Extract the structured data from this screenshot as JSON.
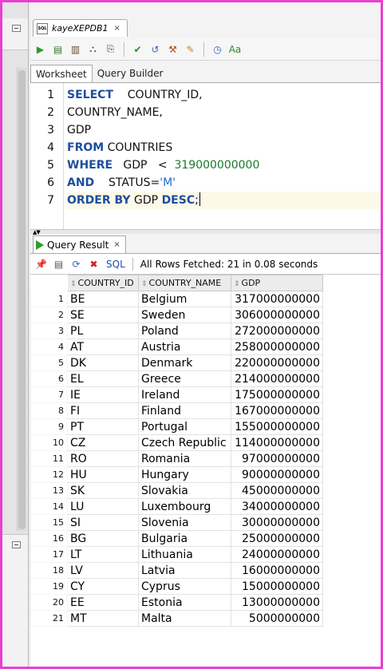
{
  "document_tab": {
    "title": "kayeXEPDB1",
    "icon": "sql-file-icon",
    "close": "×"
  },
  "toolbar": {
    "buttons": [
      {
        "name": "run-statement-icon",
        "glyph": "▶",
        "color": "#2a9d2a"
      },
      {
        "name": "run-script-icon",
        "glyph": "▤",
        "color": "#2f7a2f"
      },
      {
        "name": "commit-menu-icon",
        "glyph": "▥",
        "color": "#6b4b2a"
      },
      {
        "name": "explain-plan-icon",
        "glyph": "⛬",
        "color": "#6b4b2a"
      },
      {
        "name": "autotrace-icon",
        "glyph": "⎘",
        "color": "#555555"
      },
      {
        "name": "commit-icon",
        "glyph": "✔",
        "color": "#2a8a2a"
      },
      {
        "name": "rollback-icon",
        "glyph": "↺",
        "color": "#3b62b0"
      },
      {
        "name": "sql-tuning-icon",
        "glyph": "⚒",
        "color": "#b34a1c"
      },
      {
        "name": "clear-icon",
        "glyph": "✎",
        "color": "#c4891a"
      },
      {
        "name": "history-icon",
        "glyph": "◷",
        "color": "#2d6bb5"
      },
      {
        "name": "format-icon",
        "glyph": "Aa",
        "color": "#2a8a2a"
      }
    ]
  },
  "editor_tabs": [
    "Worksheet",
    "Query Builder"
  ],
  "editor": {
    "line_numbers": [
      "1",
      "2",
      "3",
      "4",
      "5",
      "6",
      "7"
    ],
    "lines": {
      "l1_kw": "SELECT",
      "l1_rest": "    COUNTRY_ID,",
      "l2": "COUNTRY_NAME,",
      "l3": "GDP",
      "l4_kw": "FROM",
      "l4_rest": " COUNTRIES",
      "l5_kw": "WHERE",
      "l5_mid": "   GDP   <  ",
      "l5_num": "319000000000",
      "l6_kw": "AND",
      "l6_mid": "    STATUS=",
      "l6_str": "'M'",
      "l7_kw1": "ORDER BY",
      "l7_mid": " GDP ",
      "l7_kw2": "DESC",
      "l7_end": ";"
    }
  },
  "result": {
    "tab_label": "Query Result",
    "tab_close": "×",
    "sql_label": "SQL",
    "status": "All Rows Fetched: 21 in 0.08 seconds",
    "columns": [
      "COUNTRY_ID",
      "COUNTRY_NAME",
      "GDP"
    ],
    "rows": [
      [
        "1",
        "BE",
        "Belgium",
        "317000000000"
      ],
      [
        "2",
        "SE",
        "Sweden",
        "306000000000"
      ],
      [
        "3",
        "PL",
        "Poland",
        "272000000000"
      ],
      [
        "4",
        "AT",
        "Austria",
        "258000000000"
      ],
      [
        "5",
        "DK",
        "Denmark",
        "220000000000"
      ],
      [
        "6",
        "EL",
        "Greece",
        "214000000000"
      ],
      [
        "7",
        "IE",
        "Ireland",
        "175000000000"
      ],
      [
        "8",
        "FI",
        "Finland",
        "167000000000"
      ],
      [
        "9",
        "PT",
        "Portugal",
        "155000000000"
      ],
      [
        "10",
        "CZ",
        "Czech Republic",
        "114000000000"
      ],
      [
        "11",
        "RO",
        "Romania",
        "97000000000"
      ],
      [
        "12",
        "HU",
        "Hungary",
        "90000000000"
      ],
      [
        "13",
        "SK",
        "Slovakia",
        "45000000000"
      ],
      [
        "14",
        "LU",
        "Luxembourg",
        "34000000000"
      ],
      [
        "15",
        "SI",
        "Slovenia",
        "30000000000"
      ],
      [
        "16",
        "BG",
        "Bulgaria",
        "25000000000"
      ],
      [
        "17",
        "LT",
        "Lithuania",
        "24000000000"
      ],
      [
        "18",
        "LV",
        "Latvia",
        "16000000000"
      ],
      [
        "19",
        "CY",
        "Cyprus",
        "15000000000"
      ],
      [
        "20",
        "EE",
        "Estonia",
        "13000000000"
      ],
      [
        "21",
        "MT",
        "Malta",
        "5000000000"
      ]
    ]
  },
  "colors": {
    "keyword": "#1d4f9c",
    "number": "#197a27",
    "string": "#1f6bd6",
    "frame": "#ea3fd0"
  }
}
